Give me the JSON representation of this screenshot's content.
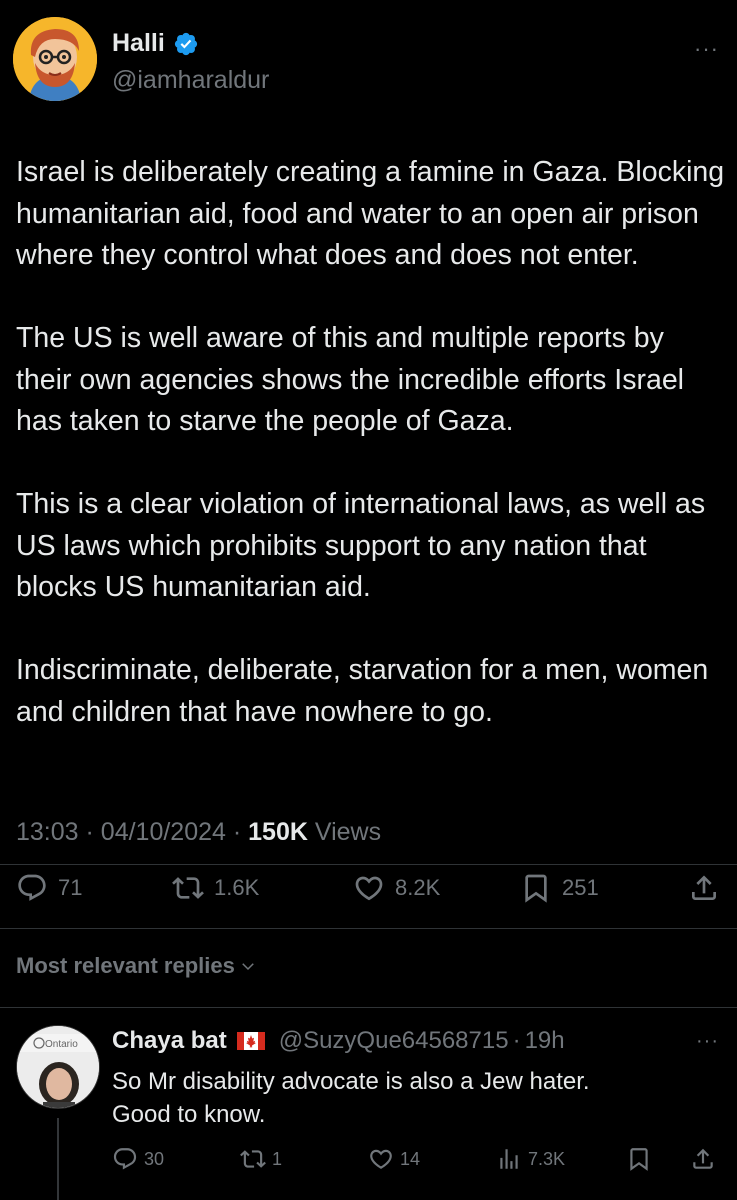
{
  "tweet": {
    "author_name": "Halli",
    "author_handle": "@iamharaldur",
    "more_label": "···",
    "paragraphs": [
      "Israel is deliberately creating a famine in Gaza. Blocking humanitarian aid, food and water to an open air prison where they control what does and does not enter.",
      "The US is well aware of this and multiple reports by their own agencies shows the incredible efforts Israel has taken to starve the people of Gaza.",
      "This is a clear violation of international laws, as well as US laws which prohibits support to any nation that blocks US humanitarian aid.",
      "Indiscriminate, deliberate, starvation for a men, women and children that have nowhere to go."
    ],
    "time": "13:03",
    "date": "04/10/2024",
    "views_count": "150K",
    "views_label": "Views",
    "replies": "71",
    "reposts": "1.6K",
    "likes": "8.2K",
    "bookmarks": "251"
  },
  "sort": {
    "label": "Most relevant replies"
  },
  "reply": {
    "author_name": "Chaya bat",
    "author_handle": "@SuzyQue64568715",
    "age": "19h",
    "avatar_caption": "Ontario",
    "more_label": "···",
    "text_line1": "So Mr disability advocate is also a Jew hater.",
    "text_line2": "Good to know.",
    "replies": "30",
    "reposts": "1",
    "likes": "14",
    "views": "7.3K"
  },
  "colors": {
    "background": "#000000",
    "text_primary": "#e7e9ea",
    "text_secondary": "#71767b",
    "verified_blue": "#1d9bf0",
    "avatar_yellow": "#f6b62b"
  }
}
